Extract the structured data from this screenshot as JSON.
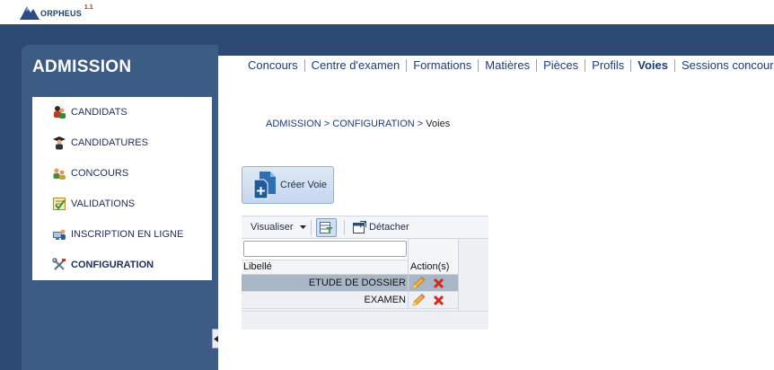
{
  "app": {
    "logo_text": "ORPHEUS",
    "logo_version": "1.1"
  },
  "sidebar": {
    "title": "ADMISSION",
    "items": [
      {
        "label": "CANDIDATS",
        "icon": "candidates-icon"
      },
      {
        "label": "CANDIDATURES",
        "icon": "graduate-icon"
      },
      {
        "label": "CONCOURS",
        "icon": "users-group-icon"
      },
      {
        "label": "VALIDATIONS",
        "icon": "checklist-icon"
      },
      {
        "label": "INSCRIPTION EN LIGNE",
        "icon": "online-registration-icon"
      },
      {
        "label": "CONFIGURATION",
        "icon": "tools-icon",
        "active": true
      }
    ]
  },
  "topnav": {
    "items": [
      "Concours",
      "Centre d'examen",
      "Formations",
      "Matières",
      "Pièces",
      "Profils",
      "Voies",
      "Sessions concours"
    ],
    "active": "Voies"
  },
  "breadcrumb": {
    "part1": "ADMISSION",
    "sep1": " > ",
    "part2": "CONFIGURATION",
    "sep2": " > ",
    "current": "Voies"
  },
  "create_button": {
    "label": "Créer Voie",
    "icon": "new-document-icon"
  },
  "grid": {
    "toolbar": {
      "view_label": "Visualiser",
      "filter_icon": "filter-row-icon",
      "detach_label": "Détacher",
      "detach_icon": "detach-window-icon"
    },
    "filter": {
      "value": "",
      "placeholder": ""
    },
    "columns": [
      "Libellé",
      "Action(s)"
    ],
    "rows": [
      {
        "label": "ETUDE DE DOSSIER",
        "selected": true
      },
      {
        "label": "EXAMEN",
        "selected": false
      }
    ],
    "action_icons": {
      "edit": "pencil-icon",
      "delete": "delete-x-icon"
    }
  },
  "colors": {
    "header_blue": "#2d4b72",
    "panel_blue": "#3c5b85",
    "link_blue": "#1d3c78",
    "selected_row": "#a9b6c6",
    "delete_red": "#d42a1e"
  }
}
